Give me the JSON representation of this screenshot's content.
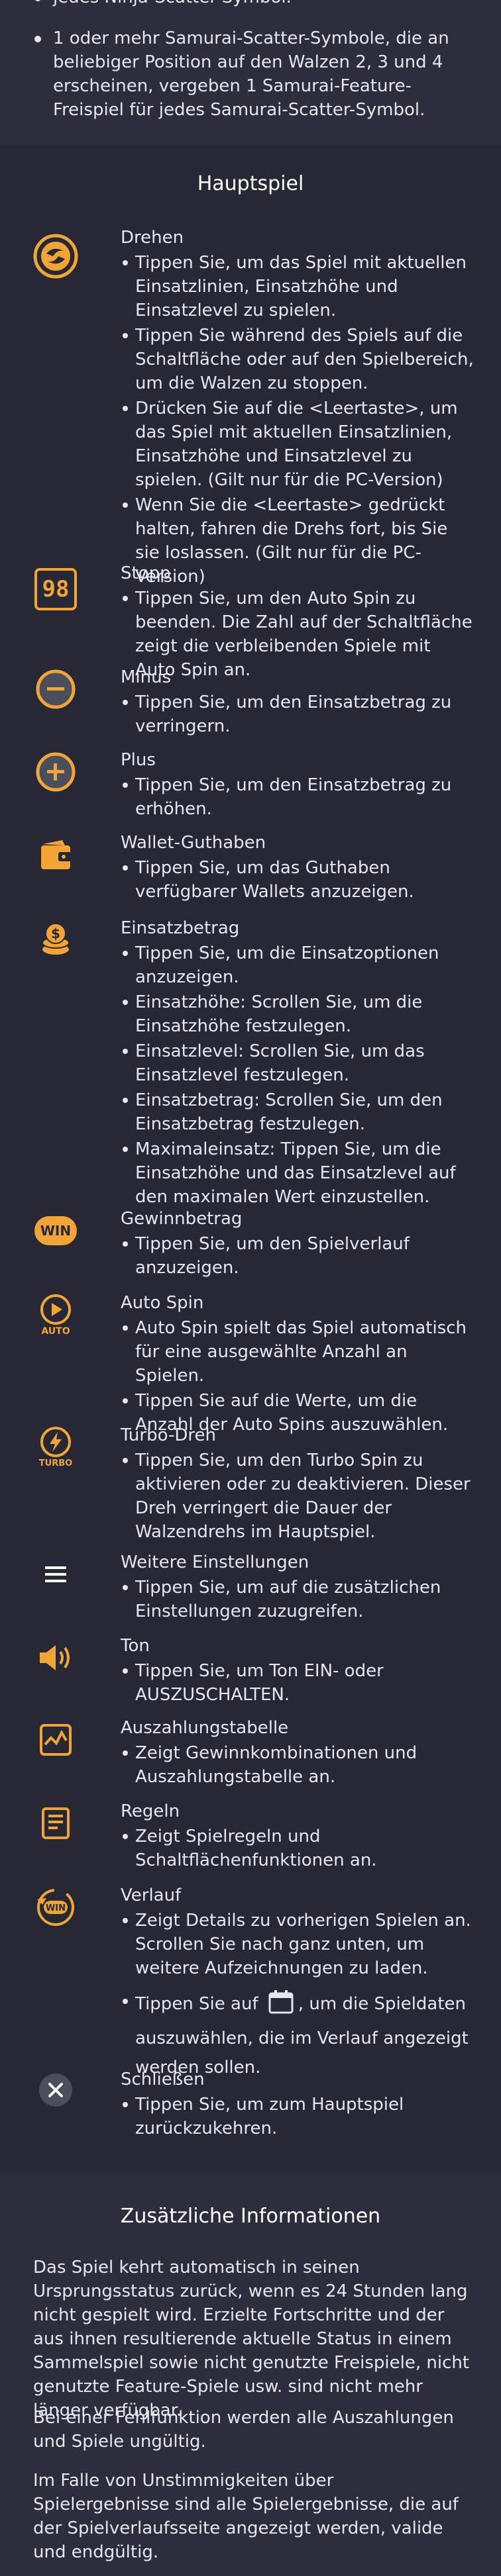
{
  "top": {
    "bullet1": "jedes Ninja-Scatter-Symbol.",
    "bullet2": "1 oder mehr Samurai-Scatter-Symbole, die an beliebiger Position auf den Walzen 2, 3 und 4 erscheinen, vergeben 1 Samurai-Feature-Freispiel für jedes Samurai-Scatter-Symbol."
  },
  "main": {
    "title": "Hauptspiel",
    "items": [
      {
        "title": "Drehen",
        "bullets": [
          "Tippen Sie, um das Spiel mit aktuellen Einsatzlinien, Einsatzhöhe und Einsatzlevel zu spielen.",
          "Tippen Sie während des Spiels auf die Schaltfläche oder auf den Spielbereich, um die Walzen zu stoppen.",
          "Drücken Sie auf die <Leertaste>, um das Spiel mit aktuellen Einsatzlinien, Einsatzhöhe und Einsatzlevel zu spielen. (Gilt nur für die PC-Version)",
          "Wenn Sie die <Leertaste> gedrückt halten, fahren die Drehs fort, bis Sie sie loslassen. (Gilt nur für die PC-Version)"
        ]
      },
      {
        "title": "Stopp",
        "icon_text": "98",
        "bullets": [
          "Tippen Sie, um den Auto Spin zu beenden. Die Zahl auf der Schaltfläche zeigt die verbleibenden Spiele mit Auto Spin an."
        ]
      },
      {
        "title": "Minus",
        "bullets": [
          "Tippen Sie, um den Einsatzbetrag zu verringern."
        ]
      },
      {
        "title": "Plus",
        "bullets": [
          "Tippen Sie, um den Einsatzbetrag zu erhöhen."
        ]
      },
      {
        "title": "Wallet-Guthaben",
        "bullets": [
          "Tippen Sie, um das Guthaben verfügbarer Wallets anzuzeigen."
        ]
      },
      {
        "title": "Einsatzbetrag",
        "bullets": [
          "Tippen Sie, um die Einsatzoptionen anzuzeigen.",
          "Einsatzhöhe: Scrollen Sie, um die Einsatzhöhe festzulegen.",
          "Einsatzlevel: Scrollen Sie, um das Einsatzlevel festzulegen.",
          "Einsatzbetrag: Scrollen Sie, um den Einsatzbetrag festzulegen.",
          "Maximaleinsatz: Tippen Sie, um die Einsatzhöhe und das Einsatzlevel auf den maximalen Wert einzustellen."
        ]
      },
      {
        "title": "Gewinnbetrag",
        "icon_text": "WIN",
        "bullets": [
          "Tippen Sie, um den Spielverlauf anzuzeigen."
        ]
      },
      {
        "title": "Auto Spin",
        "icon_text": "AUTO",
        "bullets": [
          "Auto Spin spielt das Spiel automatisch für eine ausgewählte Anzahl an Spielen.",
          "Tippen Sie auf die Werte, um die Anzahl der Auto Spins auszuwählen."
        ]
      },
      {
        "title": "Turbo-Dreh",
        "icon_text": "TURBO",
        "bullets": [
          "Tippen Sie, um den Turbo Spin zu aktivieren oder zu deaktivieren. Dieser Dreh verringert die Dauer der Walzendrehs im Hauptspiel."
        ]
      },
      {
        "title": "Weitere Einstellungen",
        "bullets": [
          "Tippen Sie, um auf die zusätzlichen Einstellungen zuzugreifen."
        ]
      },
      {
        "title": "Ton",
        "bullets": [
          "Tippen Sie, um Ton EIN- oder AUSZUSCHALTEN."
        ]
      },
      {
        "title": "Auszahlungstabelle",
        "bullets": [
          "Zeigt Gewinnkombinationen und Auszahlungstabelle an."
        ]
      },
      {
        "title": "Regeln",
        "bullets": [
          "Zeigt Spielregeln und Schaltflächenfunktionen an."
        ]
      },
      {
        "title": "Verlauf",
        "icon_text": "WIN",
        "bullets": [
          "Zeigt Details zu vorherigen Spielen an. Scrollen Sie nach ganz unten, um weitere Aufzeichnungen zu laden."
        ],
        "bullet_pre": "Tippen Sie auf",
        "bullet_post": ", um die Spieldaten auszuwählen, die im Verlauf angezeigt werden sollen."
      },
      {
        "title": "Schließen",
        "bullets": [
          "Tippen Sie, um zum Hauptspiel zurückzukehren."
        ]
      }
    ]
  },
  "extra": {
    "title": "Zusätzliche Informationen",
    "p1": "Das Spiel kehrt automatisch in seinen Ursprungsstatus zurück, wenn es 24 Stunden lang nicht gespielt wird. Erzielte Fortschritte und der aus ihnen resultierende aktuelle Status in einem Sammelspiel sowie nicht genutzte Freispiele, nicht genutzte Feature-Spiele usw. sind nicht mehr länger verfügbar.",
    "p2": "Bei einer Fehlfunktion werden alle Auszahlungen und Spiele ungültig.",
    "p3": "Im Falle von Unstimmigkeiten über Spielergebnisse sind alle Spielergebnisse, die auf der Spielverlaufsseite angezeigt werden, valide und endgültig."
  },
  "colors": {
    "accent": "#f2a437",
    "background": "#262836",
    "panel": "#2c2e3d"
  },
  "icons": [
    "spin-icon",
    "stop-icon",
    "minus-icon",
    "plus-icon",
    "wallet-icon",
    "coins-icon",
    "win-icon",
    "auto-spin-icon",
    "turbo-icon",
    "menu-icon",
    "speaker-icon",
    "paytable-icon",
    "rules-icon",
    "history-icon",
    "calendar-icon",
    "close-icon"
  ]
}
